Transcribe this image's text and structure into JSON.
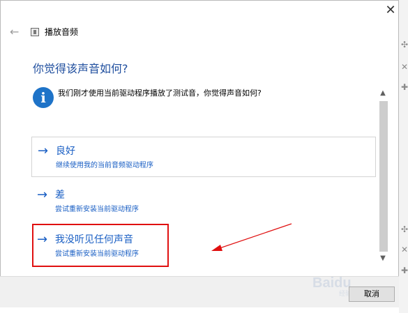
{
  "window": {
    "title": "播放音频",
    "close_glyph": "✕",
    "back_glyph": "←",
    "icons": {
      "back": "back-arrow-icon",
      "app": "speaker-app-icon",
      "close": "close-icon",
      "info": "info-icon"
    }
  },
  "heading": "你觉得该声音如何?",
  "message": {
    "icon_glyph": "i",
    "text": "我们刚才使用当前驱动程序播放了测试音，你觉得声音如何?"
  },
  "options": [
    {
      "arrow": "→",
      "title": "良好",
      "subtitle": "继续使用我的当前音频驱动程序"
    },
    {
      "arrow": "→",
      "title": "差",
      "subtitle": "尝试重新安装当前驱动程序"
    },
    {
      "arrow": "→",
      "title": "我没听见任何声音",
      "subtitle": "尝试重新安装当前驱动程序"
    }
  ],
  "scrollbar": {
    "up_glyph": "▲",
    "down_glyph": "▼"
  },
  "footer": {
    "cancel_label": "取消"
  },
  "watermark": {
    "text": "Baidu",
    "sub": "经验"
  },
  "side_glyphs": [
    "✣",
    "✕",
    "✚",
    "✣",
    "✕",
    "✚"
  ],
  "colors": {
    "heading": "#1f4e9e",
    "link": "#1a5fc4",
    "highlight": "#e01010",
    "info": "#1e73c8"
  }
}
